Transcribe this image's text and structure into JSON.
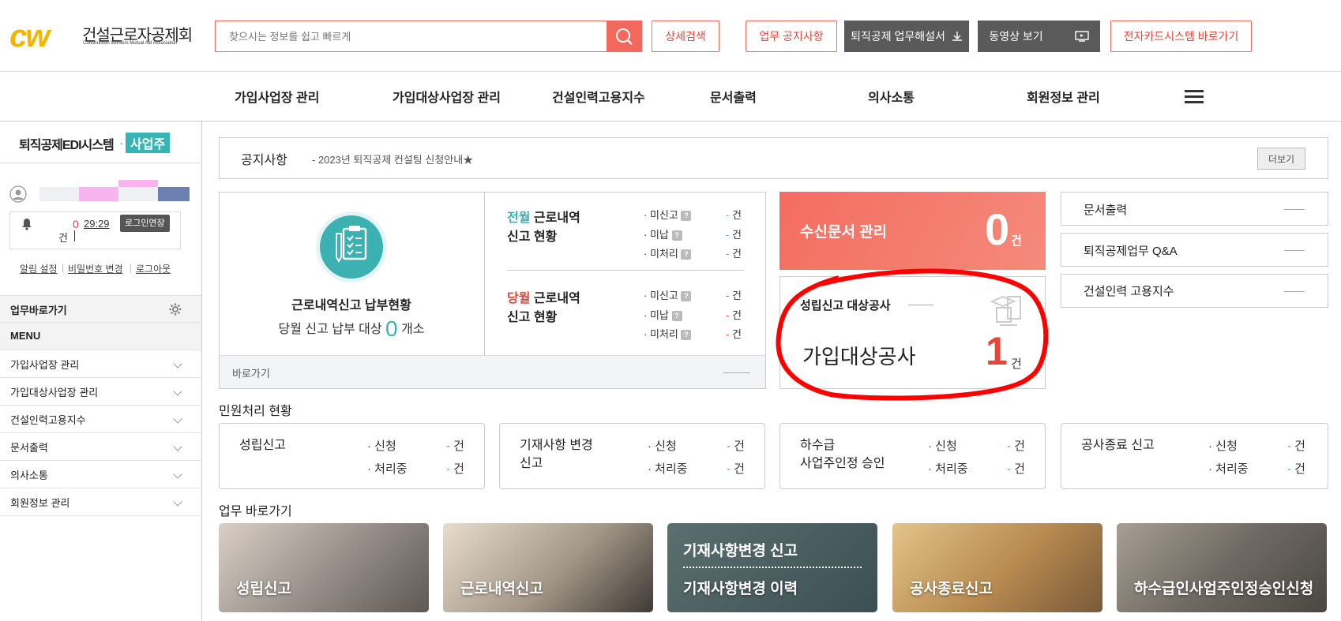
{
  "header": {
    "logo_mark": "cw",
    "logo_text": "건설근로자공제회",
    "logo_sub": "Construction Workers Mutual Aid Association",
    "search_placeholder": "찾으시는 정보를 쉽고 빠르게",
    "advanced_search": "상세검색",
    "notice_btn": "업무 공지사항",
    "manual_btn": "퇴직공제 업무해설서",
    "video_btn": "동영상 보기",
    "ecard_btn": "전자카드시스템 바로가기"
  },
  "gnb": [
    "가입사업장 관리",
    "가입대상사업장 관리",
    "건설인력고용지수",
    "문서출력",
    "의사소통",
    "회원정보 관리"
  ],
  "sidebar": {
    "title": "퇴직공제EDI시스템",
    "badge": "사업주",
    "alarm_count": "0",
    "alarm_unit": "건",
    "timer": "29:29",
    "extend_btn": "로그인연장",
    "links": [
      "알림 설정",
      "비밀번호 변경",
      "로그아웃"
    ],
    "shortcut_title": "업무바로가기",
    "menu_title": "MENU",
    "menu": [
      "가입사업장 관리",
      "가입대상사업장 관리",
      "건설인력고용지수",
      "문서출력",
      "의사소통",
      "회원정보 관리"
    ]
  },
  "notice": {
    "title": "공지사항",
    "text": "- 2023년 퇴직공제 컨설팅 신청안내★",
    "more": "더보기"
  },
  "report": {
    "title": "근로내역신고 납부현황",
    "sub_prefix": "당월 신고 납부 대상",
    "count": "0",
    "unit": "개소",
    "prev_hl": "전월",
    "prev_rest": "근로내역",
    "prev_line2": "신고 현황",
    "curr_hl": "당월",
    "curr_rest": "근로내역",
    "curr_line2": "신고 현황",
    "items": [
      "· 미신고",
      "· 미납",
      "· 미처리"
    ],
    "value": "-",
    "value_unit": "건",
    "goto": "바로가기"
  },
  "inbox": {
    "title": "수신문서 관리",
    "count": "0",
    "unit": "건"
  },
  "target": {
    "label": "성립신고 대상공사",
    "title": "가입대상공사",
    "count": "1",
    "unit": "건"
  },
  "quicklinks": [
    "문서출력",
    "퇴직공제업무 Q&A",
    "건설인력 고용지수"
  ],
  "civil": {
    "title": "민원처리 현황",
    "cards": [
      {
        "name_l1": "성립신고",
        "name_l2": ""
      },
      {
        "name_l1": "기재사항 변경",
        "name_l2": "신고"
      },
      {
        "name_l1": "하수급",
        "name_l2": "사업주인정 승인"
      },
      {
        "name_l1": "공사종료 신고",
        "name_l2": ""
      }
    ],
    "row1": "· 신청",
    "row2": "· 처리중",
    "dash": "-",
    "unit": "건"
  },
  "shortcuts": {
    "title": "업무 바로가기",
    "tiles": [
      "성립신고",
      "근로내역신고",
      "기재사항변경 신고",
      "공사종료신고",
      "하수급인사업주인정승인신청"
    ],
    "tile3_line2": "기재사항변경 이력"
  },
  "colors": {
    "accent": "#f2685a",
    "teal": "#37b5b5",
    "annotation": "#ff0000"
  }
}
